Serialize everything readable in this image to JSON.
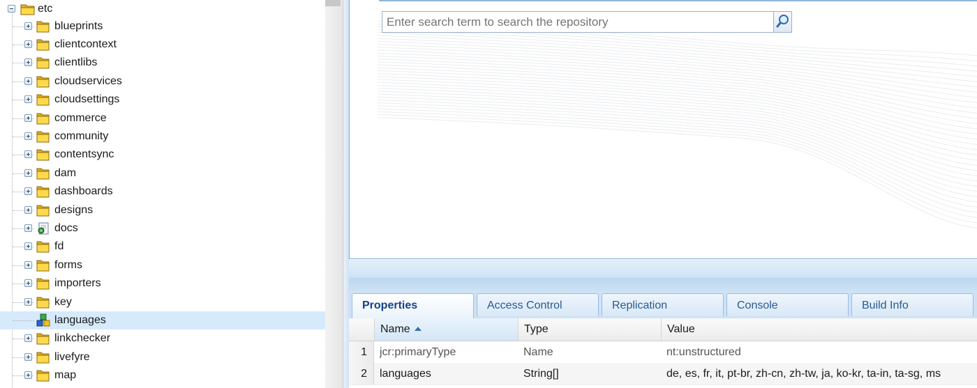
{
  "tree": {
    "root_label": "etc",
    "items": [
      {
        "label": "blueprints",
        "icon": "folder-icon",
        "expander": "plus"
      },
      {
        "label": "clientcontext",
        "icon": "folder-icon",
        "expander": "plus"
      },
      {
        "label": "clientlibs",
        "icon": "folder-icon",
        "expander": "plus"
      },
      {
        "label": "cloudservices",
        "icon": "folder-icon",
        "expander": "plus"
      },
      {
        "label": "cloudsettings",
        "icon": "folder-icon",
        "expander": "plus"
      },
      {
        "label": "commerce",
        "icon": "folder-icon",
        "expander": "plus"
      },
      {
        "label": "community",
        "icon": "folder-icon",
        "expander": "plus"
      },
      {
        "label": "contentsync",
        "icon": "folder-icon",
        "expander": "plus"
      },
      {
        "label": "dam",
        "icon": "folder-icon",
        "expander": "plus"
      },
      {
        "label": "dashboards",
        "icon": "folder-icon",
        "expander": "plus"
      },
      {
        "label": "designs",
        "icon": "folder-icon",
        "expander": "plus"
      },
      {
        "label": "docs",
        "icon": "document-page-icon",
        "expander": "plus"
      },
      {
        "label": "fd",
        "icon": "folder-icon",
        "expander": "plus"
      },
      {
        "label": "forms",
        "icon": "folder-icon",
        "expander": "plus"
      },
      {
        "label": "importers",
        "icon": "folder-icon",
        "expander": "plus"
      },
      {
        "label": "key",
        "icon": "folder-icon",
        "expander": "plus"
      },
      {
        "label": "languages",
        "icon": "node-cubes-icon",
        "expander": "none",
        "selected": true
      },
      {
        "label": "linkchecker",
        "icon": "folder-icon",
        "expander": "plus"
      },
      {
        "label": "livefyre",
        "icon": "folder-icon",
        "expander": "plus"
      },
      {
        "label": "map",
        "icon": "folder-icon",
        "expander": "plus"
      }
    ]
  },
  "search": {
    "placeholder": "Enter search term to search the repository",
    "button_icon": "magnifier-icon"
  },
  "tabs": [
    {
      "label": "Properties",
      "active": true
    },
    {
      "label": "Access Control"
    },
    {
      "label": "Replication"
    },
    {
      "label": "Console"
    },
    {
      "label": "Build Info"
    }
  ],
  "grid": {
    "columns": {
      "name": "Name",
      "type": "Type",
      "value": "Value"
    },
    "sort": "ascending",
    "rows": [
      {
        "num": "1",
        "name": "jcr:primaryType",
        "type": "Name",
        "value": "nt:unstructured"
      },
      {
        "num": "2",
        "name": "languages",
        "type": "String[]",
        "value": "de, es, fr, it, pt-br, zh-cn, zh-tw, ja, ko-kr, ta-in, ta-sg, ms"
      }
    ]
  },
  "colors": {
    "accent": "#15428b",
    "selected_row": "#d6eafc",
    "folder": "#f1c232",
    "border": "#99bbe8"
  }
}
